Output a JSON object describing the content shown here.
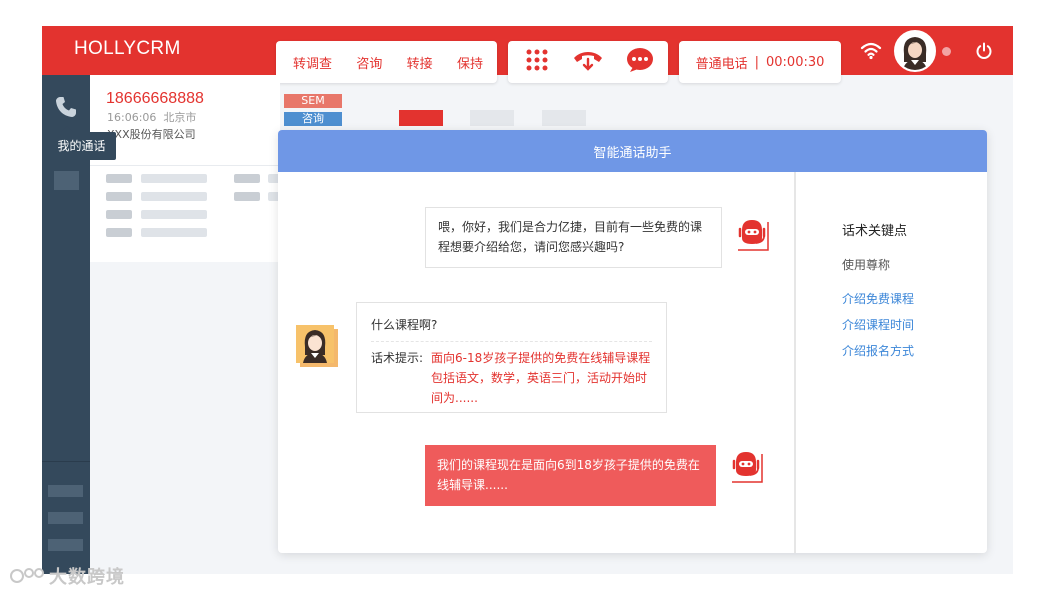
{
  "app": {
    "brand": "HOLLYCRM"
  },
  "toolbar": {
    "actions": [
      "转调查",
      "咨询",
      "转接",
      "保持"
    ],
    "call_controls": [
      "dialpad-icon",
      "hangup-icon",
      "chat-icon"
    ],
    "status": {
      "call_type": "普通电话",
      "separator": "|",
      "timer": "00:00:30"
    }
  },
  "rail": {
    "tooltip": "我的通话"
  },
  "call": {
    "number": "18666668888",
    "time": "16:06:06",
    "city": "北京市",
    "company": "XXX股份有限公司"
  },
  "tags": {
    "sem": "SEM",
    "consult": "咨询"
  },
  "assistant": {
    "title": "智能通话助手",
    "messages": {
      "bot_greeting": "喂，你好，我们是合力亿捷，目前有一些免费的课程想要介绍给您，请问您感兴趣吗?",
      "customer_question": "什么课程啊?",
      "hint_label": "话术提示:",
      "hint_text": "面向6-18岁孩子提供的免费在线辅导课程包括语文，数学，英语三门，活动开始时间为......",
      "bot_reply": "我们的课程现在是面向6到18岁孩子提供的免费在线辅导课......"
    },
    "keywords": {
      "title": "话术关键点",
      "subtitle": "使用尊称",
      "links": [
        "介绍免费课程",
        "介绍课程时间",
        "介绍报名方式"
      ]
    }
  },
  "watermark": "大数跨境",
  "colors": {
    "brand_red": "#e3332f",
    "header_blue": "#6f97e6",
    "rail_navy": "#34495c",
    "link_blue": "#3b86d8"
  }
}
